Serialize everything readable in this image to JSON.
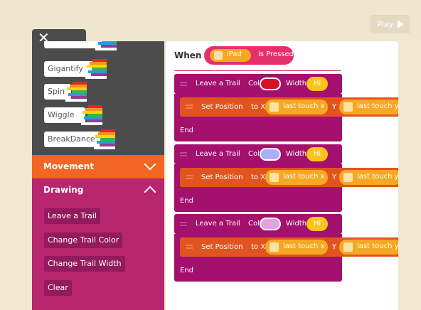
{
  "play_button": {
    "label": "Play"
  },
  "palette": {
    "close_label": "✕",
    "fun_items": [
      "Gigantify",
      "Spin",
      "Wiggle",
      "BreakDance"
    ],
    "sections": {
      "movement": {
        "title": "Movement",
        "state": "collapsed"
      },
      "drawing": {
        "title": "Drawing",
        "state": "expanded",
        "items": [
          "Leave a Trail",
          "Change Trail Color",
          "Change Trail Width",
          "Clear"
        ]
      }
    }
  },
  "script": {
    "when_label": "When",
    "trigger_object": "iPad",
    "trigger_event": "is Pressed",
    "groups": [
      {
        "trail_label": "Leave a Trail",
        "color_label": "Color",
        "color": "#d31127",
        "width_label": "Width",
        "width_value": "Hi",
        "set_label": "Set Position",
        "to_x": "to X",
        "x_value": "last touch x",
        "y_label": "Y",
        "y_value": "last touch y",
        "end_label": "End"
      },
      {
        "trail_label": "Leave a Trail",
        "color_label": "Color",
        "color": "#a9b0fb",
        "width_label": "Width",
        "width_value": "Hi",
        "set_label": "Set Position",
        "to_x": "to X",
        "x_value": "last touch x",
        "y_label": "Y",
        "y_value": "last touch y",
        "end_label": "End"
      },
      {
        "trail_label": "Leave a Trail",
        "color_label": "Color",
        "color": "#e0a3e0",
        "width_label": "Width",
        "width_value": "Hi",
        "set_label": "Set Position",
        "to_x": "to X",
        "x_value": "last touch x",
        "y_label": "Y",
        "y_value": "last touch y",
        "end_label": "End"
      }
    ]
  },
  "colors": {
    "background": "#f1e8d2",
    "palette_dark": "#4c4c4c",
    "movement_orange": "#f26522",
    "drawing_magenta": "#b7266f",
    "block_purple": "#a4106d",
    "block_orange": "#e2541f",
    "pill_yellow": "#f7a822",
    "when_pink": "#e52e6b"
  }
}
